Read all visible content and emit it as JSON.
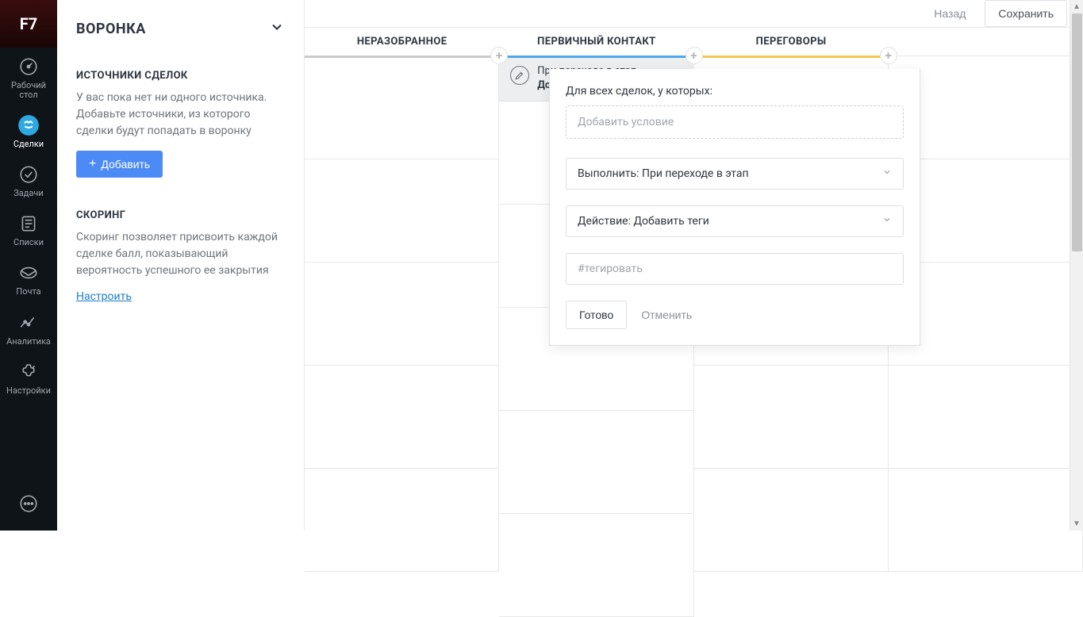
{
  "nav": {
    "logo": "F7",
    "items": [
      {
        "label": "Рабочий стол",
        "icon": "gauge"
      },
      {
        "label": "Сделки",
        "icon": "deals",
        "active": true
      },
      {
        "label": "Задачи",
        "icon": "check"
      },
      {
        "label": "Списки",
        "icon": "list"
      },
      {
        "label": "Почта",
        "icon": "mail"
      },
      {
        "label": "Аналитика",
        "icon": "analytics"
      },
      {
        "label": "Настройки",
        "icon": "settings"
      }
    ],
    "bottom_icon": "chat"
  },
  "sidebar": {
    "title": "ВОРОНКА",
    "sources": {
      "title": "ИСТОЧНИКИ СДЕЛОК",
      "text": "У вас пока нет ни одного источника. Добавьте источники, из которого сделки будут попадать в воронку",
      "add_button": "Добавить"
    },
    "scoring": {
      "title": "СКОРИНГ",
      "text": "Скоринг позволяет присвоить каждой сделке балл, показывающий вероятность успешного ее закрытия",
      "link": "Настроить"
    }
  },
  "topbar": {
    "back": "Назад",
    "save": "Сохранить"
  },
  "pipeline": {
    "stages": [
      {
        "name": "НЕРАЗОБРАННОЕ",
        "color": "gray"
      },
      {
        "name": "ПЕРВИЧНЫЙ КОНТАКТ",
        "color": "blue"
      },
      {
        "name": "ПЕРЕГОВОРЫ",
        "color": "yellow"
      },
      {
        "name": "",
        "color": "orange"
      }
    ]
  },
  "trigger": {
    "summary_line1": "При переходе в этап",
    "summary_line2": "Добавить теги:",
    "conditions_label": "Для всех сделок, у которых:",
    "add_condition_placeholder": "Добавить условие",
    "execute_select": "Выполнить: При переходе в этап",
    "action_select": "Действие: Добавить теги",
    "tag_placeholder": "#тегировать",
    "done": "Готово",
    "cancel": "Отменить"
  }
}
